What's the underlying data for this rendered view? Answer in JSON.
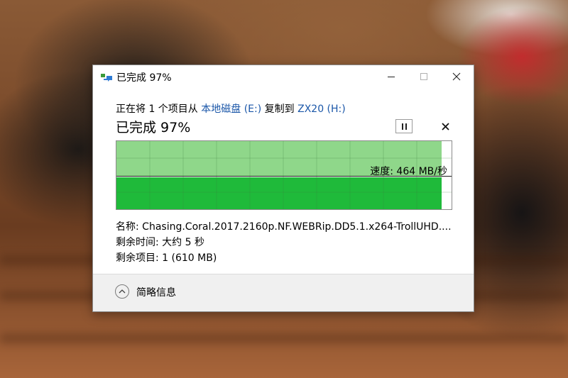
{
  "window": {
    "title": "已完成 97%",
    "minimize_icon": "minimize-icon",
    "maximize_icon": "maximize-icon",
    "close_icon": "close-icon"
  },
  "copy": {
    "prefix": "正在将 1 个项目从 ",
    "source": "本地磁盘 (E:)",
    "middle": " 复制到 ",
    "destination": "ZX20 (H:)",
    "heading": "已完成 97%",
    "progress_fraction": 0.97,
    "speed": "速度: 464 MB/秒"
  },
  "details": {
    "name": "名称: Chasing.Coral.2017.2160p.NF.WEBRip.DD5.1.x264-TrollUHD....",
    "time_remaining": "剩余时间: 大约 5 秒",
    "items_remaining": "剩余项目: 1 (610 MB)"
  },
  "footer": {
    "less_details": "简略信息"
  },
  "colors": {
    "link": "#1a56a8",
    "graph_history": "#8fd78a",
    "graph_progress": "#1fba3a"
  }
}
